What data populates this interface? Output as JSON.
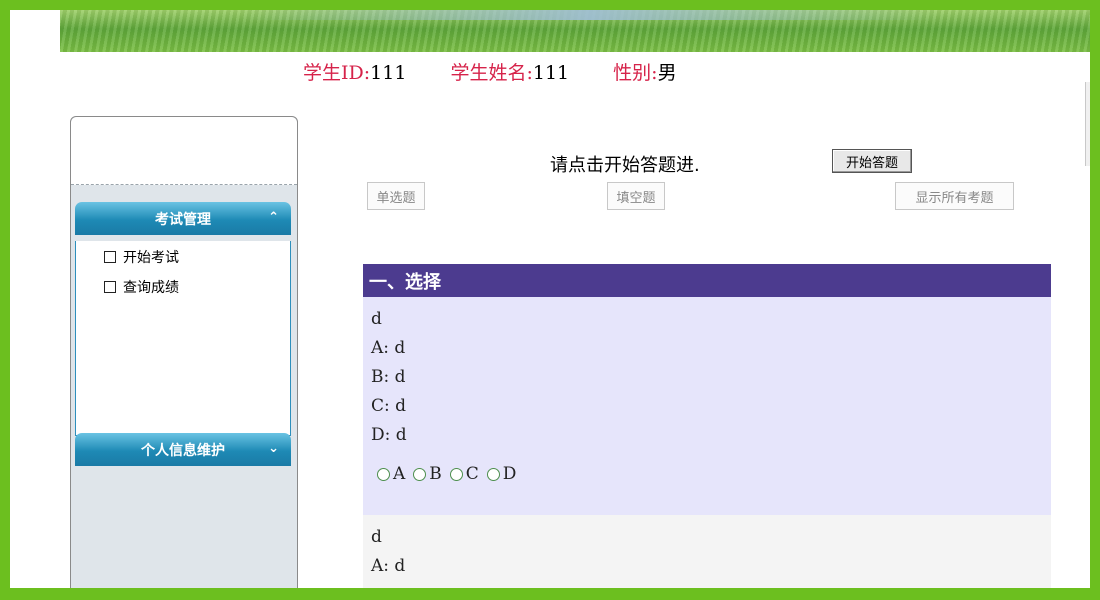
{
  "header": {
    "student_id_label": "学生ID:",
    "student_id": "111",
    "student_name_label": "学生姓名:",
    "student_name": "111",
    "gender_label": "性别:",
    "gender": "男"
  },
  "sidebar": {
    "menus": [
      {
        "label": "考试管理",
        "icon": "chevron-up-double-icon",
        "items": [
          {
            "label": "开始考试"
          },
          {
            "label": "查询成绩"
          }
        ]
      },
      {
        "label": "个人信息维护",
        "icon": "chevron-down-double-icon"
      }
    ]
  },
  "main": {
    "prompt": "请点击开始答题进.",
    "start_button": "开始答题",
    "tabs": [
      {
        "label": "单选题"
      },
      {
        "label": "填空题"
      },
      {
        "label": "显示所有考题"
      }
    ],
    "section_title": "一、选择",
    "questions": [
      {
        "stem": "d",
        "options": [
          "A: d",
          "B: d",
          "C: d",
          "D: d"
        ],
        "choices": [
          "A",
          "B",
          "C",
          "D"
        ]
      },
      {
        "stem": "d",
        "options": [
          "A: d"
        ]
      }
    ]
  },
  "colors": {
    "frame": "#6cbf1f",
    "label_red": "#d6234a",
    "section_header": "#4c3b8f",
    "question_bg": "#e6e5fb",
    "menu_blue": "#1e8ab5"
  }
}
